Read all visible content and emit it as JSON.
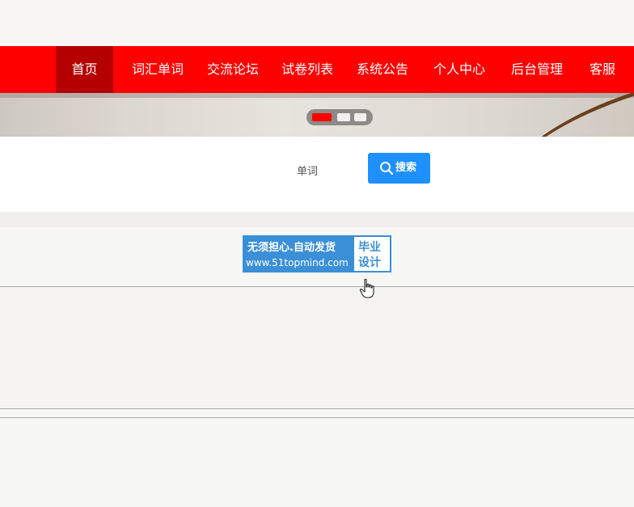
{
  "nav": {
    "items": [
      {
        "label": "首页",
        "active": true
      },
      {
        "label": "词汇单词",
        "active": false
      },
      {
        "label": "交流论坛",
        "active": false
      },
      {
        "label": "试卷列表",
        "active": false
      },
      {
        "label": "系统公告",
        "active": false
      },
      {
        "label": "个人中心",
        "active": false
      },
      {
        "label": "后台管理",
        "active": false
      },
      {
        "label": "客服",
        "active": false
      }
    ]
  },
  "banner": {
    "slide_count": 3,
    "active_slide": 1
  },
  "search": {
    "field_label": "单词",
    "button_label": "搜索",
    "button_icon": "search-icon"
  },
  "watermark": {
    "line1": "无须担心.自动发货",
    "line2": "www.51topmind.com",
    "badge_line1": "毕业",
    "badge_line2": "设计"
  },
  "colors": {
    "nav_bg": "#ff0000",
    "nav_active": "#b40000",
    "search_button": "#1e90ff",
    "watermark_blue": "#3b8fd6"
  }
}
